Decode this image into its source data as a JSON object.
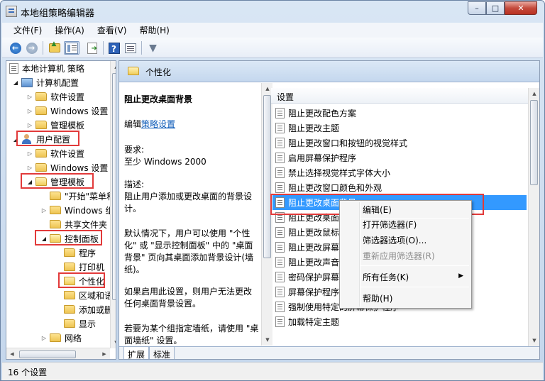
{
  "window": {
    "title": "本地组策略编辑器",
    "min": "–",
    "max": "□",
    "close": "✕"
  },
  "menu": [
    "文件(F)",
    "操作(A)",
    "查看(V)",
    "帮助(H)"
  ],
  "tree": {
    "root": "本地计算机 策略",
    "items": [
      {
        "label": "计算机配置",
        "level": 1,
        "exp": "◢",
        "icon": "computer-icon"
      },
      {
        "label": "软件设置",
        "level": 2,
        "exp": "▷",
        "icon": "folder-icon"
      },
      {
        "label": "Windows 设置",
        "level": 2,
        "exp": "▷",
        "icon": "folder-icon"
      },
      {
        "label": "管理模板",
        "level": 2,
        "exp": "▷",
        "icon": "folder-icon"
      },
      {
        "label": "用户配置",
        "level": 1,
        "exp": "◢",
        "icon": "user-icon"
      },
      {
        "label": "软件设置",
        "level": 2,
        "exp": "▷",
        "icon": "folder-icon"
      },
      {
        "label": "Windows 设置",
        "level": 2,
        "exp": "▷",
        "icon": "folder-icon"
      },
      {
        "label": "管理模板",
        "level": 2,
        "exp": "◢",
        "icon": "folder-icon"
      },
      {
        "label": "\"开始\"菜单和任务栏",
        "level": 3,
        "exp": "",
        "icon": "folder-icon"
      },
      {
        "label": "Windows 组件",
        "level": 3,
        "exp": "▷",
        "icon": "folder-icon"
      },
      {
        "label": "共享文件夹",
        "level": 3,
        "exp": "",
        "icon": "folder-icon"
      },
      {
        "label": "控制面板",
        "level": 3,
        "exp": "◢",
        "icon": "folder-icon"
      },
      {
        "label": "程序",
        "level": 4,
        "exp": "",
        "icon": "folder-icon"
      },
      {
        "label": "打印机",
        "level": 4,
        "exp": "",
        "icon": "folder-icon"
      },
      {
        "label": "个性化",
        "level": 4,
        "exp": "",
        "icon": "folder-icon"
      },
      {
        "label": "区域和语言",
        "level": 4,
        "exp": "",
        "icon": "folder-icon"
      },
      {
        "label": "添加或删除程序",
        "level": 4,
        "exp": "",
        "icon": "folder-icon"
      },
      {
        "label": "显示",
        "level": 4,
        "exp": "",
        "icon": "folder-icon"
      },
      {
        "label": "网络",
        "level": 3,
        "exp": "▷",
        "icon": "folder-icon"
      }
    ]
  },
  "right": {
    "header": "个性化",
    "desc": {
      "title": "阻止更改桌面背景",
      "edit_prefix": "编辑",
      "edit_link": "策略设置",
      "req_label": "要求:",
      "req_value": "至少 Windows 2000",
      "desc_label": "描述:",
      "desc_p1": "阻止用户添加或更改桌面的背景设计。",
      "desc_p2": "默认情况下，用户可以使用 \"个性化\" 或 \"显示控制面板\" 中的 \"桌面背景\" 页向其桌面添加背景设计(墙纸)。",
      "desc_p3": "如果启用此设置，则用户无法更改任何桌面背景设置。",
      "desc_p4": "若要为某个组指定墙纸，请使用 \"桌面墙纸\" 设置。"
    },
    "list_header": "设置",
    "settings": [
      "阻止更改配色方案",
      "阻止更改主题",
      "阻止更改窗口和按钮的视觉样式",
      "启用屏幕保护程序",
      "禁止选择视觉样式字体大小",
      "阻止更改窗口颜色和外观",
      "阻止更改桌面背景",
      "阻止更改桌面图标",
      "阻止更改鼠标指针",
      "阻止更改屏幕保护程序",
      "阻止更改声音",
      "密码保护屏幕保护程序",
      "屏幕保护程序超时",
      "强制使用特定的屏幕保护程序",
      "加载特定主题"
    ],
    "tabs": [
      "扩展",
      "标准"
    ]
  },
  "context_menu": {
    "items": [
      "编辑(E)",
      "打开筛选器(F)",
      "筛选器选项(O)...",
      "重新应用筛选器(R)",
      "所有任务(K)",
      "帮助(H)"
    ],
    "submenu_arrow": "▶"
  },
  "status": "16 个设置"
}
